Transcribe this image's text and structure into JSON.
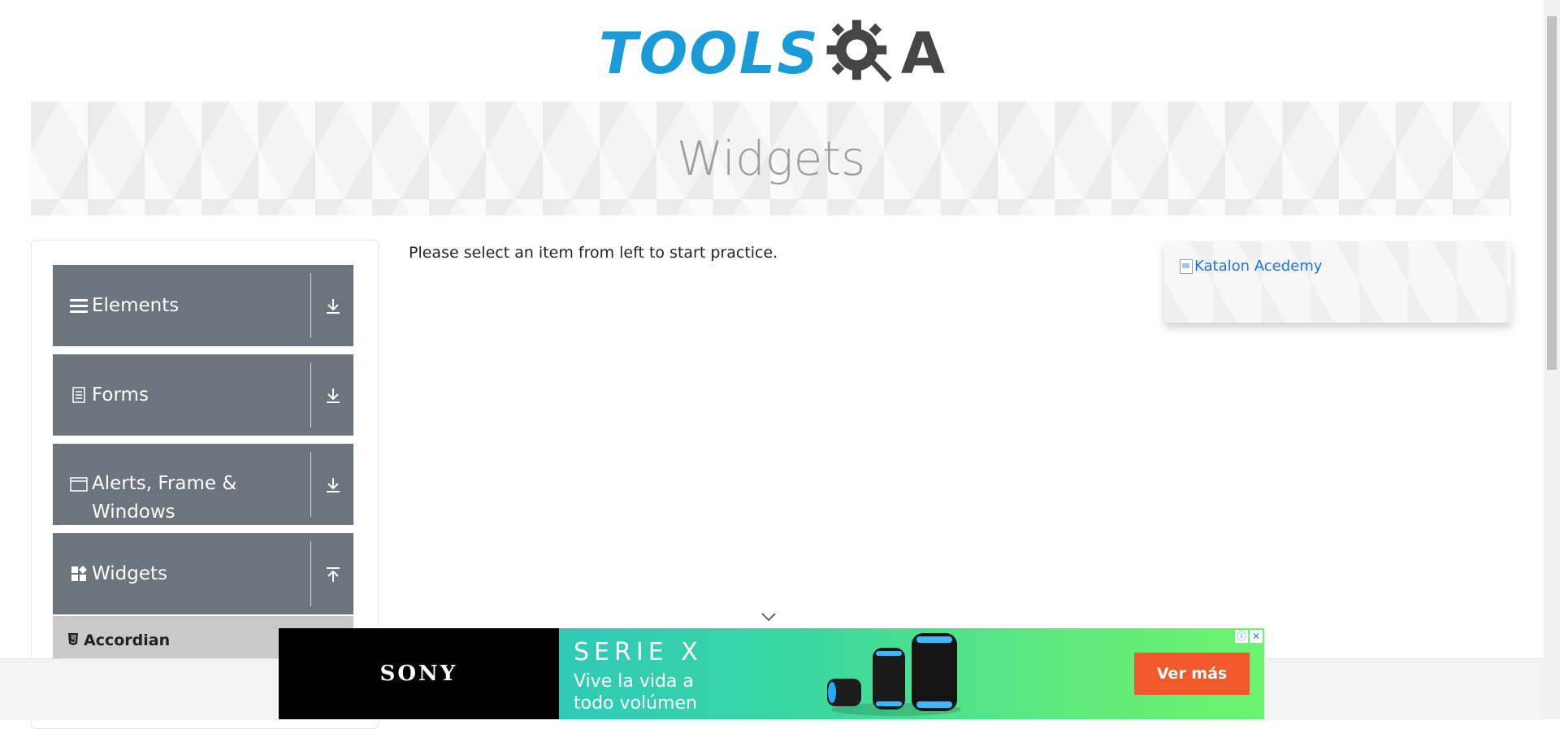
{
  "header": {
    "logo_part1": "TOOLS",
    "logo_part2": "A",
    "logo_alt": "ToolsQA"
  },
  "banner": {
    "title": "Widgets"
  },
  "sidebar": {
    "groups": [
      {
        "label": "Elements",
        "icon": "hamburger-icon",
        "toggle_icon": "download-arrow-icon"
      },
      {
        "label": "Forms",
        "icon": "document-icon",
        "toggle_icon": "download-arrow-icon"
      },
      {
        "label": "Alerts, Frame & Windows",
        "icon": "window-icon",
        "toggle_icon": "download-arrow-icon"
      },
      {
        "label": "Widgets",
        "icon": "widgets-icon",
        "toggle_icon": "upload-arrow-icon"
      }
    ],
    "active_item": {
      "label": "Accordian",
      "icon": "html5-icon"
    }
  },
  "main": {
    "message": "Please select an item from left to start practice."
  },
  "right_ad": {
    "alt_text": "Katalon Acedemy"
  },
  "ad": {
    "brand": "SONY",
    "series": "SERIE X",
    "line1": "Vive la vida a",
    "line2": "todo volúmen",
    "cta": "Ver más",
    "info_icon": "ⓘ",
    "close_icon": "✕"
  },
  "colors": {
    "sidebar_group_bg": "#6c757d",
    "active_item_bg": "#c9c9c9",
    "logo_blue": "#1a9ad6",
    "logo_dark": "#454545",
    "cta_orange": "#f05a2b"
  }
}
